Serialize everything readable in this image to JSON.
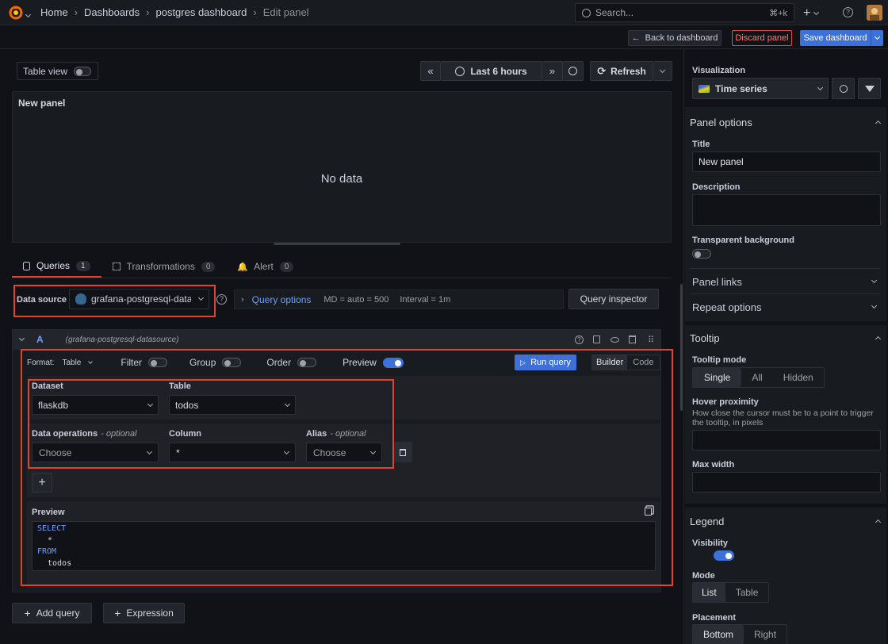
{
  "topbar": {
    "breadcrumbs": [
      "Home",
      "Dashboards",
      "postgres dashboard",
      "Edit panel"
    ],
    "search_placeholder": "Search...",
    "search_shortcut": "⌘+k"
  },
  "actions": {
    "back": "Back to dashboard",
    "discard": "Discard panel",
    "save": "Save dashboard"
  },
  "toolbar": {
    "table_view": "Table view",
    "time_range": "Last 6 hours",
    "refresh": "Refresh"
  },
  "panel": {
    "title": "New panel",
    "empty": "No data"
  },
  "tabs": [
    {
      "label": "Queries",
      "count": "1"
    },
    {
      "label": "Transformations",
      "count": "0"
    },
    {
      "label": "Alert",
      "count": "0"
    }
  ],
  "datasource": {
    "label": "Data source",
    "value": "grafana-postgresql-datasource",
    "query_options": "Query options",
    "md": "MD = auto = 500",
    "interval": "Interval = 1m",
    "inspector": "Query inspector"
  },
  "query": {
    "ref": "A",
    "source": "(grafana-postgresql-datasource)",
    "format_label": "Format:",
    "format_value": "Table",
    "filter": "Filter",
    "group": "Group",
    "order": "Order",
    "preview": "Preview",
    "run": "Run query",
    "builder": "Builder",
    "code": "Code",
    "dataset_label": "Dataset",
    "dataset_value": "flaskdb",
    "table_label": "Table",
    "table_value": "todos",
    "dataops_label": "Data operations",
    "optional": "- optional",
    "dataops_value": "Choose",
    "column_label": "Column",
    "column_value": "*",
    "alias_label": "Alias",
    "alias_value": "Choose",
    "preview_title": "Preview",
    "sql": [
      "SELECT",
      "*",
      "FROM",
      "todos"
    ]
  },
  "bottom": {
    "add_query": "Add query",
    "expression": "Expression"
  },
  "options": {
    "viz_label": "Visualization",
    "viz_value": "Time series",
    "panel_options": "Panel options",
    "title_label": "Title",
    "title_value": "New panel",
    "description_label": "Description",
    "transparent_label": "Transparent background",
    "panel_links": "Panel links",
    "repeat_options": "Repeat options",
    "tooltip": "Tooltip",
    "tooltip_mode": "Tooltip mode",
    "tooltip_modes": [
      "Single",
      "All",
      "Hidden"
    ],
    "hover_label": "Hover proximity",
    "hover_desc": "How close the cursor must be to a point to trigger the tooltip, in pixels",
    "max_width": "Max width",
    "legend": "Legend",
    "visibility": "Visibility",
    "mode": "Mode",
    "modes": [
      "List",
      "Table"
    ],
    "placement": "Placement",
    "placements": [
      "Bottom",
      "Right"
    ]
  },
  "colors": {
    "accent": "#3d71d9",
    "highlight": "#e0442c",
    "discard": "#e24d42"
  }
}
